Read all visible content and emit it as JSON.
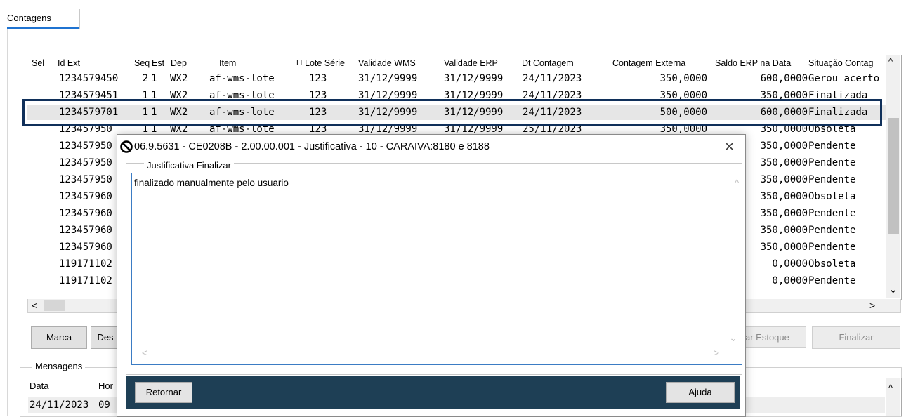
{
  "tab": {
    "label": "Contagens"
  },
  "grid": {
    "columns": {
      "sel": "Sel",
      "id_ext": "Id Ext",
      "seq": "Seq",
      "est": "Est",
      "dep": "Dep",
      "item": "Item",
      "ii": "I I",
      "lote": "Lote Série",
      "val_wms": "Validade WMS",
      "val_erp": "Validade ERP",
      "dt": "Dt Contagem",
      "contagem": "Contagem Externa",
      "saldo": "Saldo ERP na Data",
      "situacao": "Situação Contag"
    },
    "rows": [
      {
        "id": "1234579450",
        "seq": "2",
        "est": "1",
        "dep": "WX2",
        "item": "af-wms-lote",
        "lote": "123",
        "val_wms": "31/12/9999",
        "val_erp": "31/12/9999",
        "dt": "24/11/2023",
        "contagem": "350,0000",
        "saldo": "600,0000",
        "sit": "Gerou acerto"
      },
      {
        "id": "1234579451",
        "seq": "1",
        "est": "1",
        "dep": "WX2",
        "item": "af-wms-lote",
        "lote": "123",
        "val_wms": "31/12/9999",
        "val_erp": "31/12/9999",
        "dt": "24/11/2023",
        "contagem": "350,0000",
        "saldo": "350,0000",
        "sit": "Finalizada"
      },
      {
        "id": "1234579701",
        "seq": "1",
        "est": "1",
        "dep": "WX2",
        "item": "af-wms-lote",
        "lote": "123",
        "val_wms": "31/12/9999",
        "val_erp": "31/12/9999",
        "dt": "24/11/2023",
        "contagem": "500,0000",
        "saldo": "600,0000",
        "sit": "Finalizada"
      },
      {
        "id": "123457950",
        "seq": "1",
        "est": "1",
        "dep": "WX2",
        "item": "af-wms-lote",
        "lote": "123",
        "val_wms": "31/12/9999",
        "val_erp": "31/12/9999",
        "dt": "25/11/2023",
        "contagem": "350,0000",
        "saldo": "350,0000",
        "sit": "Obsoleta"
      },
      {
        "id": "123457950",
        "saldo": "350,0000",
        "sit": "Pendente"
      },
      {
        "id": "123457950",
        "saldo": "350,0000",
        "sit": "Pendente"
      },
      {
        "id": "123457950",
        "saldo": "350,0000",
        "sit": "Pendente"
      },
      {
        "id": "123457960",
        "saldo": "350,0000",
        "sit": "Obsoleta"
      },
      {
        "id": "123457960",
        "saldo": "350,0000",
        "sit": "Pendente"
      },
      {
        "id": "123457960",
        "saldo": "350,0000",
        "sit": "Pendente"
      },
      {
        "id": "123457960",
        "saldo": "350,0000",
        "sit": "Pendente"
      },
      {
        "id": "119171102",
        "saldo": "0,0000",
        "sit": "Obsoleta"
      },
      {
        "id": "119171102",
        "saldo": "0,0000",
        "sit": "Pendente"
      }
    ]
  },
  "buttons": {
    "marca": "Marca",
    "des": "Des",
    "estoque": "ar Estoque",
    "finalizar": "Finalizar"
  },
  "messages": {
    "title": "Mensagens",
    "col_data": "Data",
    "col_hora": "Hor",
    "row_date": "24/11/2023",
    "row_time": "09"
  },
  "dialog": {
    "title": "06.9.5631 - CE0208B - 2.00.00.001 - Justificativa - 10 - CARAIVA:8180 e 8188",
    "group_title": "Justificativa Finalizar",
    "text": "finalizado manualmente pelo usuario",
    "btn_return": "Retornar",
    "btn_help": "Ajuda",
    "close": "×"
  },
  "scroll_glyphs": {
    "up": "^",
    "down": "⌄",
    "left": "<",
    "right": ">"
  },
  "colors": {
    "accent": "#1f73d1",
    "highlight_border": "#10305a",
    "footer": "#1e3f55",
    "selected_row": "#e6e6e6"
  },
  "icons": [
    "close-icon",
    "app-logo-icon",
    "scroll-up-icon",
    "scroll-down-icon",
    "scroll-left-icon",
    "scroll-right-icon"
  ]
}
